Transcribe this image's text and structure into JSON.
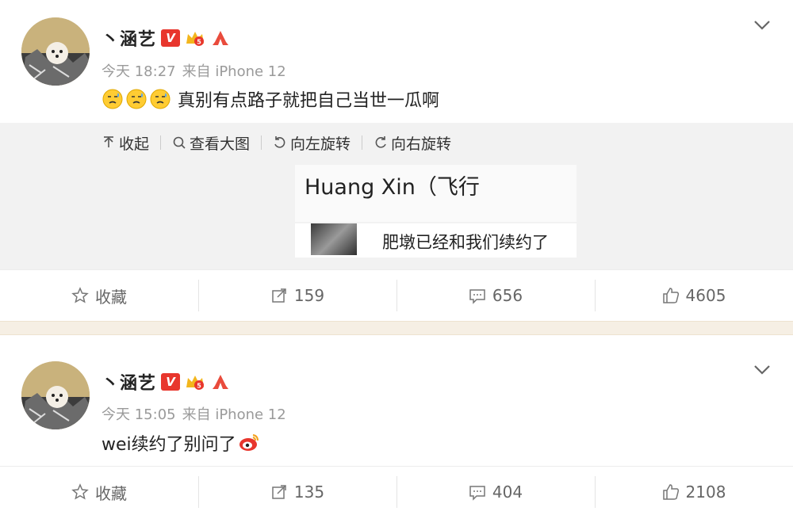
{
  "posts": [
    {
      "username": "丶涵艺",
      "badges": [
        "v-verified-badge",
        "crown-badge",
        "hands-badge"
      ],
      "time": "今天 18:27",
      "source": "来自 iPhone 12",
      "text": "真别有点路子就把自己当世一瓜啊",
      "emoji": [
        "sweat-face",
        "sweat-face",
        "sweat-face"
      ],
      "media_toolbar": {
        "collapse": "收起",
        "view_large": "查看大图",
        "rotate_left": "向左旋转",
        "rotate_right": "向右旋转"
      },
      "image": {
        "title": "Huang Xin（飞行",
        "message": "肥墩已经和我们续约了"
      },
      "actions": {
        "favorite": "收藏",
        "repost": "159",
        "comment": "656",
        "like": "4605"
      }
    },
    {
      "username": "丶涵艺",
      "badges": [
        "v-verified-badge",
        "crown-badge",
        "hands-badge"
      ],
      "time": "今天 15:05",
      "source": "来自 iPhone 12",
      "text": "wei续约了别问了",
      "emoji": [
        "weibo-logo"
      ],
      "actions": {
        "favorite": "收藏",
        "repost": "135",
        "comment": "404",
        "like": "2108"
      }
    }
  ],
  "colors": {
    "vip_red": "#e8362d",
    "meta_gray": "#9a9a9a",
    "separator": "#f6efe4",
    "media_bg": "#f2f2f2"
  }
}
